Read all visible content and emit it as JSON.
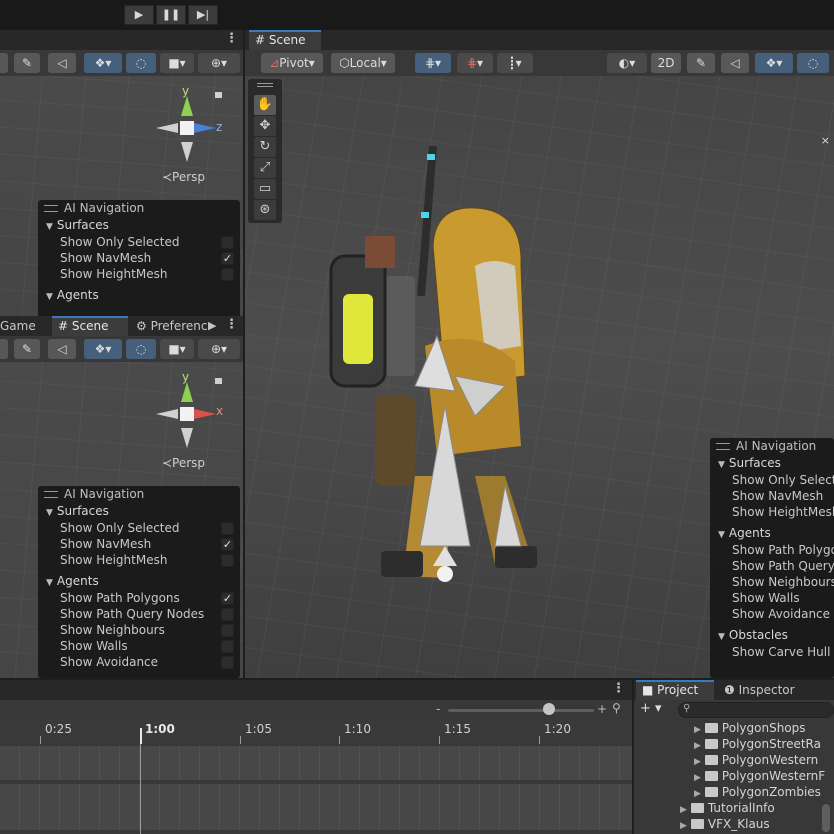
{
  "play_controls": [
    "▶",
    "❚❚",
    "▶|"
  ],
  "left_top": {
    "kebab": "⋮",
    "persp": "≺Persp",
    "gizmo_axes": {
      "y": "y",
      "z": "z"
    }
  },
  "left_tabs": [
    {
      "label": "Game"
    },
    {
      "label": "# Scene"
    },
    {
      "label": "⚙ Preferenc"
    }
  ],
  "left_bottom": {
    "persp": "≺Persp",
    "gizmo_axes": {
      "y": "y",
      "x": "x"
    }
  },
  "scene": {
    "tab": "# Scene",
    "toolbar": {
      "pivot": "Pivot",
      "local": "Local",
      "two_d": "2D"
    }
  },
  "ai_nav_top": {
    "title": "AI Navigation",
    "surfaces": "Surfaces",
    "surface_items": [
      {
        "label": "Show Only Selected",
        "checked": false
      },
      {
        "label": "Show NavMesh",
        "checked": true
      },
      {
        "label": "Show HeightMesh",
        "checked": false
      }
    ],
    "agents": "Agents"
  },
  "ai_nav_bottom": {
    "title": "AI Navigation",
    "surfaces": "Surfaces",
    "surface_items": [
      {
        "label": "Show Only Selected",
        "checked": false
      },
      {
        "label": "Show NavMesh",
        "checked": true
      },
      {
        "label": "Show HeightMesh",
        "checked": false
      }
    ],
    "agents": "Agents",
    "agent_items": [
      {
        "label": "Show Path Polygons",
        "checked": true
      },
      {
        "label": "Show Path Query Nodes",
        "checked": false
      },
      {
        "label": "Show Neighbours",
        "checked": false
      },
      {
        "label": "Show Walls",
        "checked": false
      },
      {
        "label": "Show Avoidance",
        "checked": false
      }
    ]
  },
  "ai_nav_right": {
    "title": "AI Navigation",
    "surfaces": "Surfaces",
    "surface_items": [
      "Show Only Selecte",
      "Show NavMesh",
      "Show HeightMesh"
    ],
    "agents": "Agents",
    "agent_items": [
      "Show Path Polygo",
      "Show Path Query",
      "Show Neighbours",
      "Show Walls",
      "Show Avoidance"
    ],
    "obstacles": "Obstacles",
    "obstacle_items": [
      "Show Carve Hull"
    ]
  },
  "timeline": {
    "ticks": [
      "0:25",
      "1:00",
      "1:05",
      "1:10",
      "1:15",
      "1:20"
    ]
  },
  "project": {
    "tabs": [
      "Project",
      "Inspector"
    ],
    "add_label": "+ ▾",
    "folders": [
      {
        "label": "PolygonShops",
        "indent": 2
      },
      {
        "label": "PolygonStreetRa",
        "indent": 2
      },
      {
        "label": "PolygonWestern",
        "indent": 2
      },
      {
        "label": "PolygonWesternF",
        "indent": 2
      },
      {
        "label": "PolygonZombies",
        "indent": 2
      },
      {
        "label": "TutorialInfo",
        "indent": 1
      },
      {
        "label": "VFX_Klaus",
        "indent": 1
      }
    ]
  },
  "colors": {
    "accent": "#3a79bb",
    "gizmo_y": "#8ed150",
    "gizmo_z": "#4a7fd8",
    "gizmo_x": "#d9534a"
  }
}
